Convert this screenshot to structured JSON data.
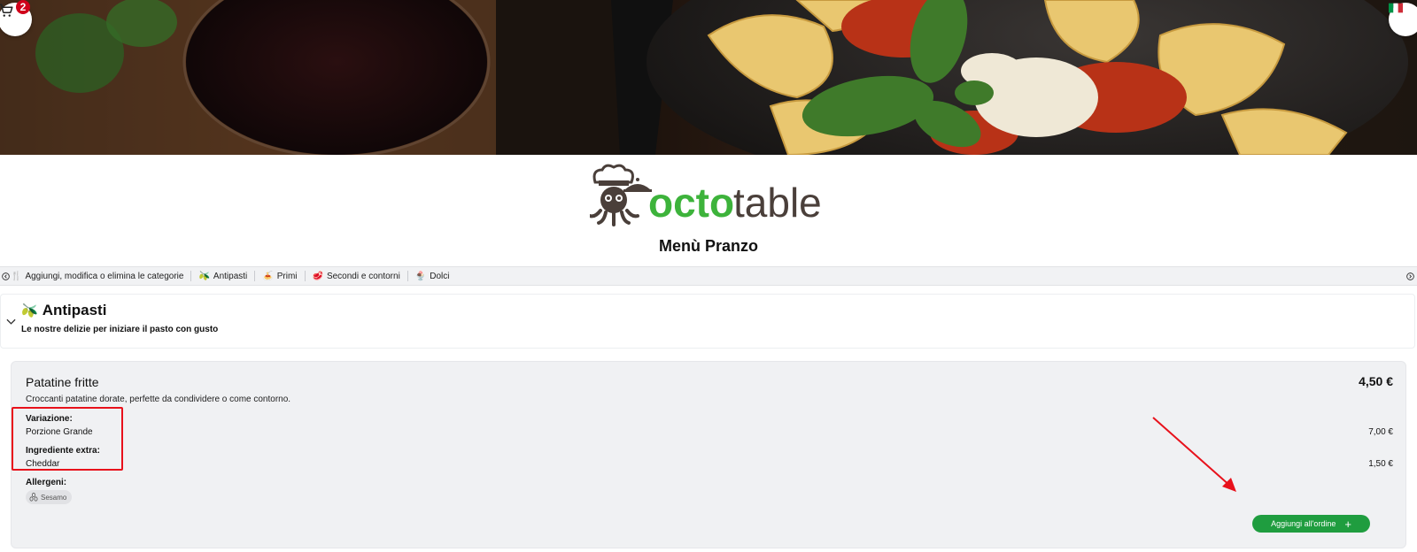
{
  "header": {
    "cart_count": "2",
    "cart_icon": "cart-icon",
    "language_flag": "italian-flag-icon"
  },
  "brand": {
    "logo_word_1": "octo",
    "logo_word_2": "table",
    "logo_color_primary": "#3db33b",
    "logo_color_secondary": "#4a3f3a",
    "menu_title": "Menù Pranzo"
  },
  "category_bar": {
    "items": [
      {
        "icon": "⚙",
        "label": "Aggiungi, modifica o elimina le categorie"
      },
      {
        "icon": "🫒",
        "label": "Antipasti"
      },
      {
        "icon": "🍝",
        "label": "Primi"
      },
      {
        "icon": "🥩",
        "label": "Secondi e contorni"
      },
      {
        "icon": "🍨",
        "label": "Dolci"
      }
    ]
  },
  "section": {
    "icon": "🫒",
    "title": "Antipasti",
    "subtitle": "Le nostre delizie per iniziare il pasto con gusto"
  },
  "product": {
    "name": "Patatine fritte",
    "price": "4,50 €",
    "description": "Croccanti patatine dorate, perfette da condividere o come contorno.",
    "variation_label": "Variazione:",
    "variation_value": "Porzione Grande",
    "variation_price": "7,00 €",
    "extra_label": "Ingrediente extra:",
    "extra_value": "Cheddar",
    "extra_price": "1,50 €",
    "allergens_label": "Allergeni:",
    "allergens": [
      "Sesamo"
    ],
    "add_button_label": "Aggiungi all'ordine",
    "add_button_icon": "+",
    "accent_color": "#1f9d3f"
  },
  "annotations": {
    "color": "#e8111b"
  }
}
